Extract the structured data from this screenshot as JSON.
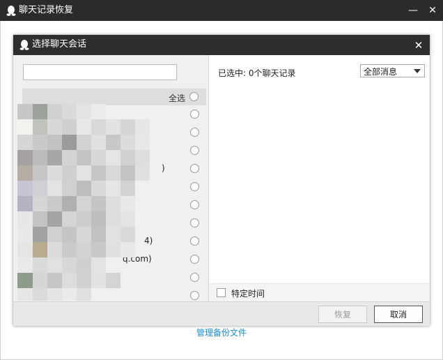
{
  "window": {
    "title": "聊天记录恢复",
    "minimize_glyph": "—",
    "close_glyph": "✕"
  },
  "dialog": {
    "title": "选择聊天会话",
    "close_glyph": "✕"
  },
  "left_pane": {
    "search": {
      "value": "",
      "placeholder": ""
    },
    "select_all_label": "全选",
    "contacts": [
      {
        "text": ""
      },
      {
        "text": ""
      },
      {
        "text": ""
      },
      {
        "text": ")"
      },
      {
        "text": ""
      },
      {
        "text": ""
      },
      {
        "text": ""
      },
      {
        "text": "4)"
      },
      {
        "text": "q.com)"
      },
      {
        "text": ""
      },
      {
        "text": ""
      }
    ]
  },
  "right_pane": {
    "selected_summary": "已选中: 0个聊天记录",
    "filter_selected": "全部消息",
    "specific_time_label": "特定时间"
  },
  "footer": {
    "restore_label": "恢复",
    "cancel_label": "取消"
  },
  "manage_backup_label": "管理备份文件",
  "colors": {
    "titlebar": "#2b2b2b",
    "link": "#1a8fd8",
    "disabled_text": "#9a9a9a"
  },
  "icons": {
    "app": "qq-penguin-icon",
    "minimize": "minimize-icon",
    "close": "close-icon",
    "dropdown": "chevron-down-icon"
  }
}
